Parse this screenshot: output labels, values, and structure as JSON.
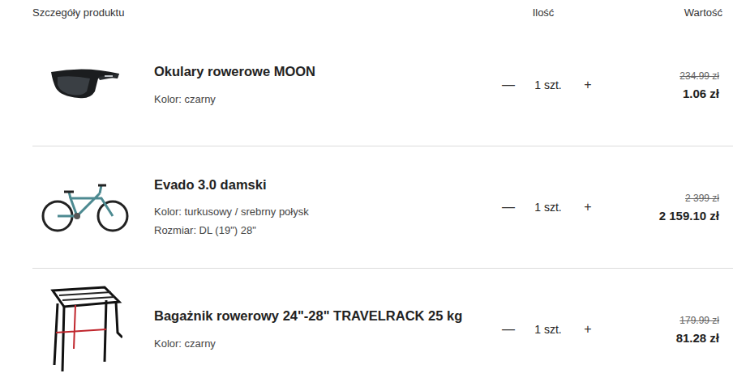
{
  "header": {
    "product": "Szczegóły produktu",
    "quantity": "Ilość",
    "value": "Wartość"
  },
  "items": [
    {
      "name": "Okulary rowerowe MOON",
      "attributes": [
        "Kolor: czarny"
      ],
      "decrement": "—",
      "quantity": "1 szt.",
      "increment": "+",
      "old_price": "234.99 zł",
      "price": "1.06 zł"
    },
    {
      "name": "Evado 3.0 damski",
      "attributes": [
        "Kolor: turkusowy / srebrny połysk",
        "Rozmiar: DL (19\") 28\""
      ],
      "decrement": "—",
      "quantity": "1 szt.",
      "increment": "+",
      "old_price": "2 399 zł",
      "price": "2 159.10 zł"
    },
    {
      "name": "Bagażnik rowerowy 24\"-28\" TRAVELRACK 25 kg",
      "attributes": [
        "Kolor: czarny"
      ],
      "decrement": "—",
      "quantity": "1 szt.",
      "increment": "+",
      "old_price": "179.99 zł",
      "price": "81.28 zł"
    }
  ]
}
